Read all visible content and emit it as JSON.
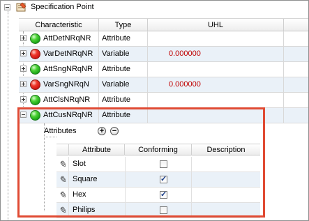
{
  "tree": {
    "root_label": "Specification Point"
  },
  "columns": [
    "Characteristic",
    "Type",
    "UHL"
  ],
  "rows": [
    {
      "name": "AttDetNRqNR",
      "status": "green",
      "type": "Attribute",
      "uhl": "",
      "expander": "plus"
    },
    {
      "name": "VarDetNRqNR",
      "status": "red",
      "type": "Variable",
      "uhl": "0.000000",
      "expander": "plus"
    },
    {
      "name": "AttSngNRqNR",
      "status": "green",
      "type": "Attribute",
      "uhl": "",
      "expander": "plus"
    },
    {
      "name": "VarSngNRqN",
      "status": "red",
      "type": "Variable",
      "uhl": "0.000000",
      "expander": "plus"
    },
    {
      "name": "AttClsNRqNR",
      "status": "green",
      "type": "Attribute",
      "uhl": "",
      "expander": "plus"
    },
    {
      "name": "AttCusNRqNR",
      "status": "green",
      "type": "Attribute",
      "uhl": "",
      "expander": "minus"
    }
  ],
  "attributes_panel": {
    "label": "Attributes",
    "add_symbol": "+",
    "remove_symbol": "−",
    "columns": [
      "Attribute",
      "Conforming",
      "Description"
    ],
    "rows": [
      {
        "name": "Slot",
        "conforming": false
      },
      {
        "name": "Square",
        "conforming": true
      },
      {
        "name": "Hex",
        "conforming": true
      },
      {
        "name": "Philips",
        "conforming": false
      }
    ]
  },
  "colors": {
    "highlight": "#e04a33",
    "row_alt": "#eaf1f8",
    "uhl_value": "#c00000"
  }
}
